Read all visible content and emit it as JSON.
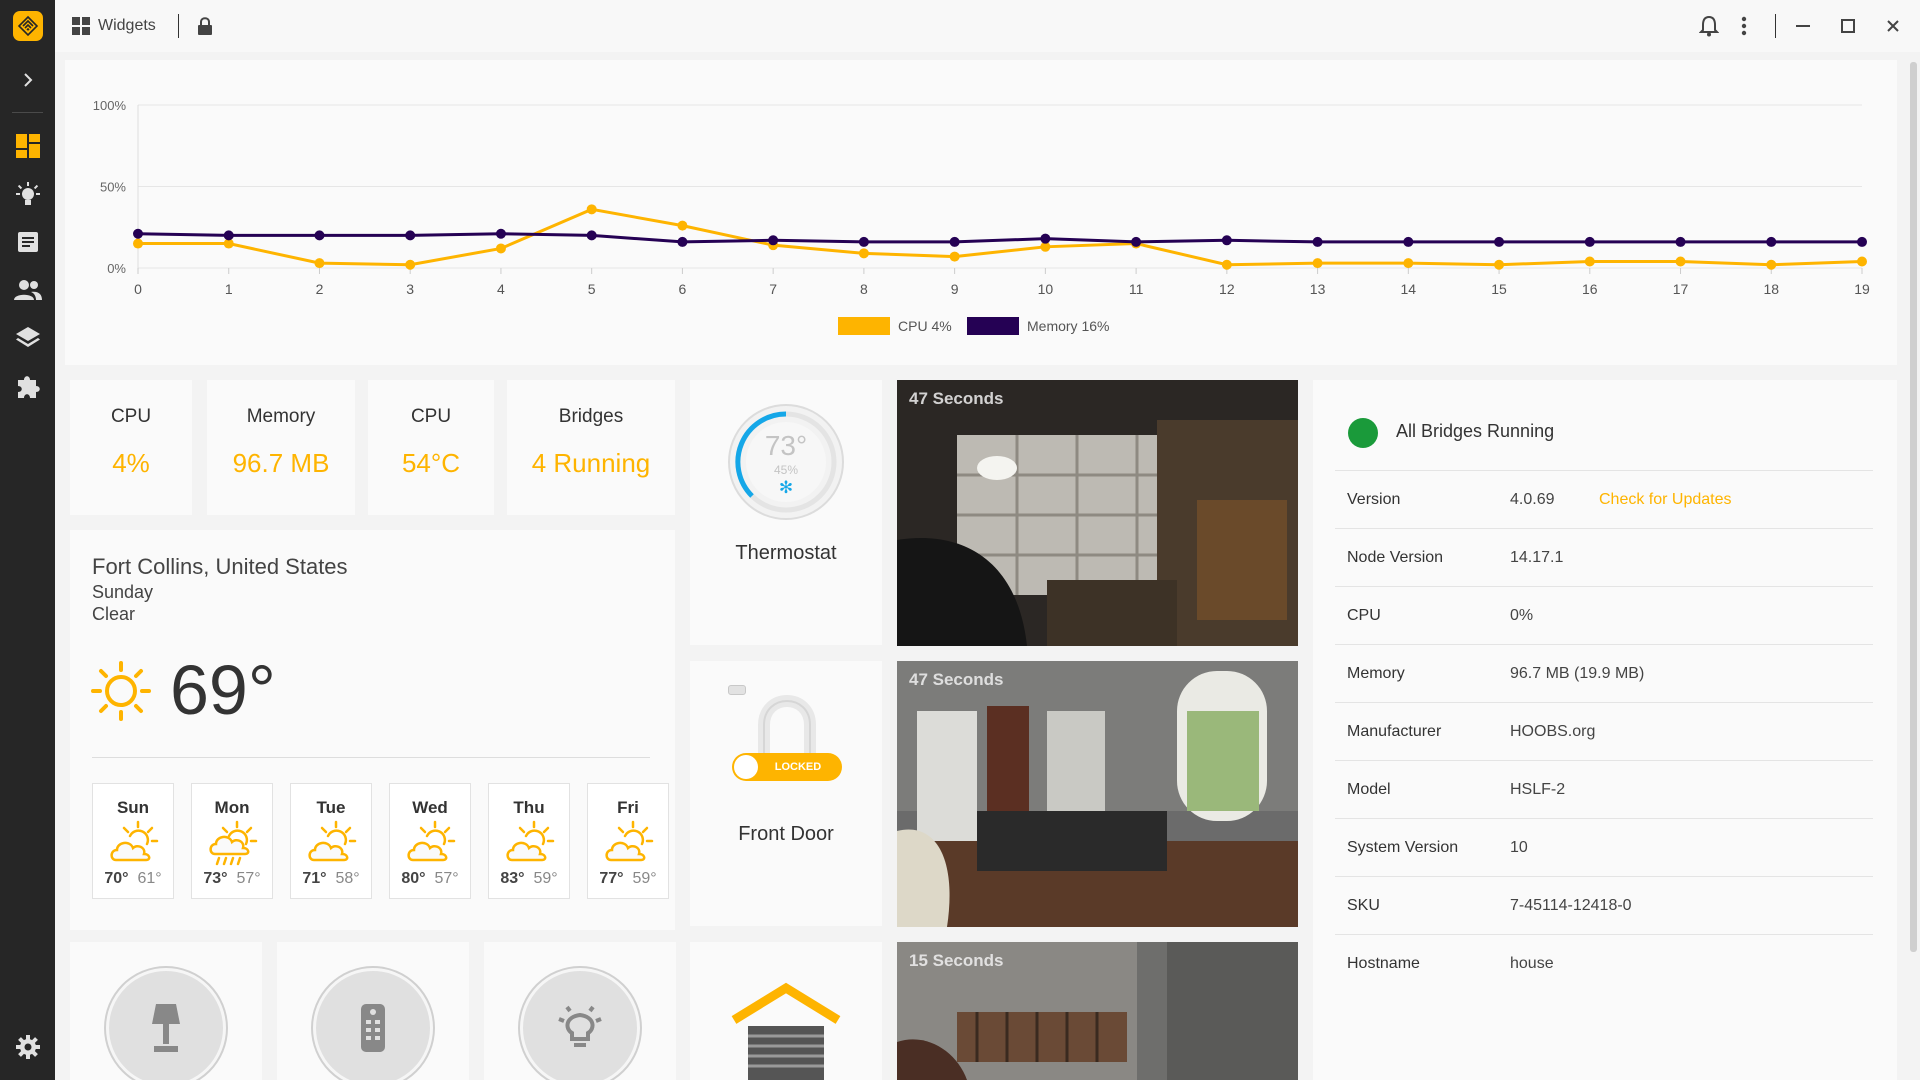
{
  "topbar": {
    "title": "Widgets"
  },
  "chart_data": {
    "type": "line",
    "x": [
      0,
      1,
      2,
      3,
      4,
      5,
      6,
      7,
      8,
      9,
      10,
      11,
      12,
      13,
      14,
      15,
      16,
      17,
      18,
      19
    ],
    "ylim": [
      0,
      100
    ],
    "yticks": [
      "100%",
      "50%",
      "0%"
    ],
    "grid": true,
    "legend_placement": "bottom-center",
    "series": [
      {
        "name": "CPU 4%",
        "color": "#feb400",
        "values": [
          15,
          15,
          3,
          2,
          12,
          36,
          26,
          14,
          9,
          7,
          13,
          15,
          2,
          3,
          3,
          2,
          4,
          4,
          2,
          4
        ]
      },
      {
        "name": "Memory 16%",
        "color": "#250154",
        "values": [
          21,
          20,
          20,
          20,
          21,
          20,
          16,
          17,
          16,
          16,
          18,
          16,
          17,
          16,
          16,
          16,
          16,
          16,
          16,
          16
        ]
      }
    ]
  },
  "stats": [
    {
      "label": "CPU",
      "value": "4%"
    },
    {
      "label": "Memory",
      "value": "96.7 MB"
    },
    {
      "label": "CPU",
      "value": "54°C"
    },
    {
      "label": "Bridges",
      "value": "4 Running"
    }
  ],
  "weather": {
    "location": "Fort Collins, United States",
    "day": "Sunday",
    "condition": "Clear",
    "temp": "69°",
    "forecast": [
      {
        "day": "Sun",
        "high": "70°",
        "low": "61°",
        "icon": "partly-cloudy-icon"
      },
      {
        "day": "Mon",
        "high": "73°",
        "low": "57°",
        "icon": "rain-icon"
      },
      {
        "day": "Tue",
        "high": "71°",
        "low": "58°",
        "icon": "partly-cloudy-icon"
      },
      {
        "day": "Wed",
        "high": "80°",
        "low": "57°",
        "icon": "partly-cloudy-icon"
      },
      {
        "day": "Thu",
        "high": "83°",
        "low": "59°",
        "icon": "partly-cloudy-icon"
      },
      {
        "day": "Fri",
        "high": "77°",
        "low": "59°",
        "icon": "partly-cloudy-icon"
      }
    ]
  },
  "thermostat": {
    "name": "Thermostat",
    "temp": "73°",
    "humidity": "45%"
  },
  "lock": {
    "name": "Front Door",
    "state": "LOCKED"
  },
  "cameras": [
    {
      "label": "47 Seconds"
    },
    {
      "label": "47 Seconds"
    },
    {
      "label": "15 Seconds"
    }
  ],
  "system": {
    "status": "All Bridges Running",
    "status_color": "#1a9a3a",
    "update_link": "Check for Updates",
    "rows": [
      {
        "key": "Version",
        "value": "4.0.69"
      },
      {
        "key": "Node Version",
        "value": "14.17.1"
      },
      {
        "key": "CPU",
        "value": "0%"
      },
      {
        "key": "Memory",
        "value": "96.7 MB (19.9 MB)"
      },
      {
        "key": "Manufacturer",
        "value": "HOOBS.org"
      },
      {
        "key": "Model",
        "value": "HSLF-2"
      },
      {
        "key": "System Version",
        "value": "10"
      },
      {
        "key": "SKU",
        "value": "7-45114-12418-0"
      },
      {
        "key": "Hostname",
        "value": "house"
      }
    ]
  },
  "colors": {
    "accent": "#feb400",
    "sidebar": "#262626",
    "memory": "#250154"
  }
}
